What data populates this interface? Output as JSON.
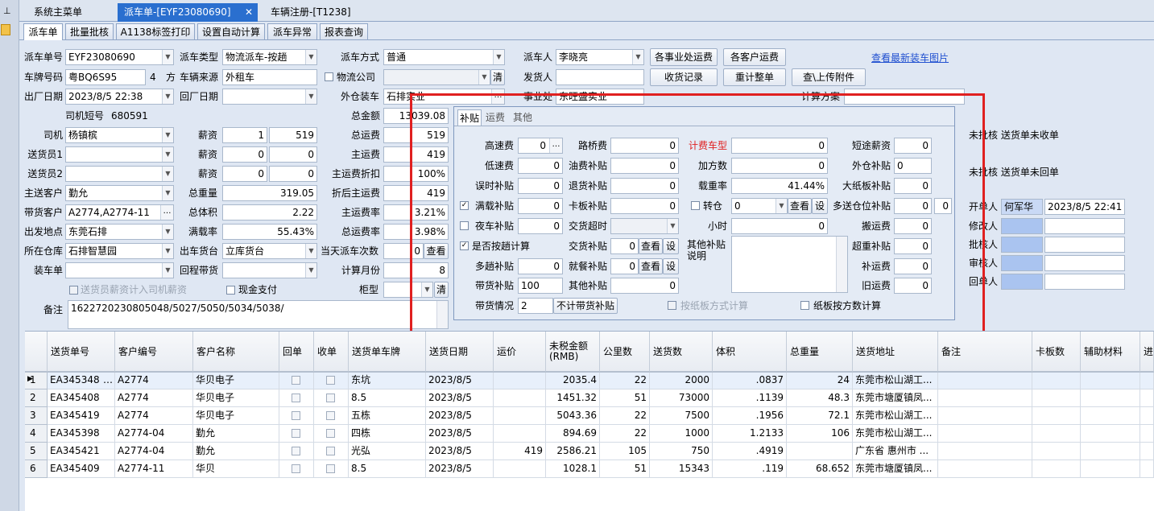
{
  "window_tabs": [
    {
      "label": "系统主菜单"
    },
    {
      "label": "派车单-[EYF23080690]"
    },
    {
      "label": "车辆注册-[T1238]"
    }
  ],
  "sub_tabs": [
    "派车单",
    "批量批核",
    "A1138标签打印",
    "设置自动计算",
    "派车异常",
    "报表查询"
  ],
  "form": {
    "dispatch_no_label": "派车单号",
    "dispatch_no": "EYF23080690",
    "dispatch_type_label": "派车类型",
    "dispatch_type": "物流派车-按趟",
    "dispatch_mode_label": "派车方式",
    "dispatch_mode": "普通",
    "dispatcher_label": "派车人",
    "dispatcher": "李晓亮",
    "plate_label": "车牌号码",
    "plate": "粤BQ6S95",
    "volume": "4",
    "volume_unit": "方",
    "vehicle_source_label": "车辆来源",
    "vehicle_source": "外租车",
    "logistics_company_label": "物流公司",
    "clear_label": "清",
    "consignor_label": "发货人",
    "out_date_label": "出厂日期",
    "out_date": "2023/8/5 22:38",
    "return_date_label": "回厂日期",
    "outside_loading_label": "外仓装车",
    "outside_loading": "石排实业",
    "business_unit_label": "事业处",
    "business_unit": "东旺盛实业",
    "calc_plan_label": "计算方案",
    "driver_short_label": "司机短号",
    "driver_short": "680591",
    "total_amount_label": "总金额",
    "total_amount": "13039.08",
    "driver_label": "司机",
    "driver": "杨镇槟",
    "salary_label": "薪资",
    "driver_salary_a": "1",
    "driver_salary_b": "519",
    "total_freight_label": "总运费",
    "total_freight": "519",
    "deliverer1_label": "送货员1",
    "deliverer1_salary_a": "0",
    "deliverer1_salary_b": "0",
    "main_freight_label": "主运费",
    "main_freight": "419",
    "deliverer2_label": "送货员2",
    "deliverer2_salary_a": "0",
    "deliverer2_salary_b": "0",
    "main_discount_label": "主运费折扣",
    "main_discount": "100%",
    "main_customer_label": "主送客户",
    "main_customer": "勤允",
    "total_weight_label": "总重量",
    "total_weight": "319.05",
    "after_discount_label": "折后主运费",
    "after_discount": "419",
    "carry_customer_label": "带货客户",
    "carry_customer": "A2774,A2774-11",
    "total_volume_label": "总体积",
    "total_volume": "2.22",
    "main_freight_rate_label": "主运费率",
    "main_freight_rate": "3.21%",
    "departure_label": "出发地点",
    "departure": "东莞石排",
    "load_rate_label": "满载率",
    "load_rate": "55.43%",
    "total_freight_rate_label": "总运费率",
    "total_freight_rate": "3.98%",
    "warehouse_label": "所在仓库",
    "warehouse": "石排智慧园",
    "out_platform_label": "出车货台",
    "out_platform": "立库货台",
    "daily_count_label": "当天派车次数",
    "daily_count": "0",
    "view_label": "查看",
    "loader_label": "装车单",
    "return_goods_label": "回程带货",
    "calc_month_label": "计算月份",
    "calc_month": "8",
    "deliverer_salary_cb": "送货员薪资计入司机薪资",
    "cash_pay_cb": "现金支付",
    "cabinet_label": "柜型",
    "remark_label": "备注",
    "remark": "1622720230805048/5027/5050/5034/5038/"
  },
  "buttons": {
    "each_business_freight": "各事业处运费",
    "each_customer_freight": "各客户运费",
    "receipt_record": "收货记录",
    "recalc_order": "重计整单",
    "view_upload_attach": "查\\上传附件"
  },
  "link_latest_photo": "查看最新装车图片",
  "popup": {
    "tabs": [
      "补贴",
      "运费",
      "其他"
    ],
    "fields": {
      "highway_label": "高速费",
      "highway": "0",
      "bridge_label": "路桥费",
      "bridge": "0",
      "charge_vehicle_label": "计费车型",
      "charge_vehicle": "0",
      "short_salary_label": "短途薪资",
      "short_salary": "0",
      "low_speed_label": "低速费",
      "low_speed": "0",
      "fuel_label": "油费补贴",
      "fuel": "0",
      "add_cube_label": "加方数",
      "add_cube": "0",
      "outside_subsidy_label": "外仓补贴",
      "outside_subsidy": "0",
      "delay_label": "误时补贴",
      "delay": "0",
      "return_goods_label": "退货补贴",
      "return_goods": "0",
      "load_rate_label": "载重率",
      "load_rate": "41.44%",
      "big_board_label": "大纸板补贴",
      "big_board": "0",
      "full_load_label": "满载补贴",
      "full_load": "0",
      "card_board_label": "卡板补贴",
      "card_board": "0",
      "transfer_label": "转仓",
      "transfer": "0",
      "view_label": "查看",
      "set_label": "设",
      "multi_location_label": "多送仓位补贴",
      "multi_location_a": "0",
      "multi_location_b": "0",
      "night_label": "夜车补贴",
      "night": "0",
      "delivery_timeout_label": "交货超时",
      "hours_label": "小时",
      "hours": "0",
      "carry_freight_label": "搬运费",
      "carry_freight": "0",
      "per_trip_label": "是否按趟计算",
      "handover_label": "交货补贴",
      "handover": "0",
      "over_weight_label": "超重补贴",
      "over_weight": "0",
      "multi_trip_label": "多趟补贴",
      "multi_trip": "0",
      "meal_label": "就餐补贴",
      "meal": "0",
      "other_subsidy_note_label": "其他补贴说明",
      "supplement_label": "补运费",
      "supplement": "0",
      "carry_subsidy_label": "带货补贴",
      "carry_subsidy": "100",
      "other_label": "其他补贴",
      "other": "0",
      "old_freight_label": "旧运费",
      "old_freight": "0",
      "carry_status_label": "带货情况",
      "carry_status": "2",
      "no_carry_calc": "不计带货补贴",
      "board_mode_label": "按纸板方式计算",
      "board_count_label": "纸板按方数计算"
    }
  },
  "right_panel": {
    "status1": "未批核 送货单未收单",
    "status2": "未批核 送货单未回单",
    "opener_label": "开单人",
    "opener": "何军华",
    "open_time": "2023/8/5 22:41",
    "modifier_label": "修改人",
    "approver_label": "批核人",
    "auditor_label": "审核人",
    "returner_label": "回单人"
  },
  "table": {
    "headers": [
      "送货单号",
      "客户编号",
      "客户名称",
      "回单",
      "收单",
      "送货单车牌",
      "送货日期",
      "运价",
      "未税金额(RMB)",
      "公里数",
      "送货数",
      "体积",
      "总重量",
      "送货地址",
      "备注",
      "卡板数",
      "辅助材料",
      "进"
    ],
    "rows": [
      [
        "EA345348",
        "A2774",
        "华贝电子",
        "",
        "",
        "东坑",
        "2023/8/5",
        "",
        "2035.4",
        "22",
        "2000",
        ".0837",
        "24",
        "东莞市松山湖工..."
      ],
      [
        "EA345408",
        "A2774",
        "华贝电子",
        "",
        "",
        "8.5",
        "2023/8/5",
        "",
        "1451.32",
        "51",
        "73000",
        ".1139",
        "48.3",
        "东莞市塘厦镇凤..."
      ],
      [
        "EA345419",
        "A2774",
        "华贝电子",
        "",
        "",
        "五栋",
        "2023/8/5",
        "",
        "5043.36",
        "22",
        "7500",
        ".1956",
        "72.1",
        "东莞市松山湖工..."
      ],
      [
        "EA345398",
        "A2774-04",
        "勤允",
        "",
        "",
        "四栋",
        "2023/8/5",
        "",
        "894.69",
        "22",
        "1000",
        "1.2133",
        "106",
        "东莞市松山湖工..."
      ],
      [
        "EA345421",
        "A2774-04",
        "勤允",
        "",
        "",
        "光弘",
        "2023/8/5",
        "419",
        "2586.21",
        "105",
        "750",
        ".4919",
        "",
        "广东省 惠州市 ..."
      ],
      [
        "EA345409",
        "A2774-11",
        "华贝",
        "",
        "",
        "8.5",
        "2023/8/5",
        "",
        "1028.1",
        "51",
        "15343",
        ".119",
        "68.652",
        "东莞市塘厦镇凤..."
      ]
    ],
    "row_numbers": [
      "1",
      "2",
      "3",
      "4",
      "5",
      "6"
    ]
  },
  "colors": {
    "highlight_red": "#e02020",
    "accent_blue": "#1f4fd0",
    "tab_active": "#2a6fcf"
  }
}
